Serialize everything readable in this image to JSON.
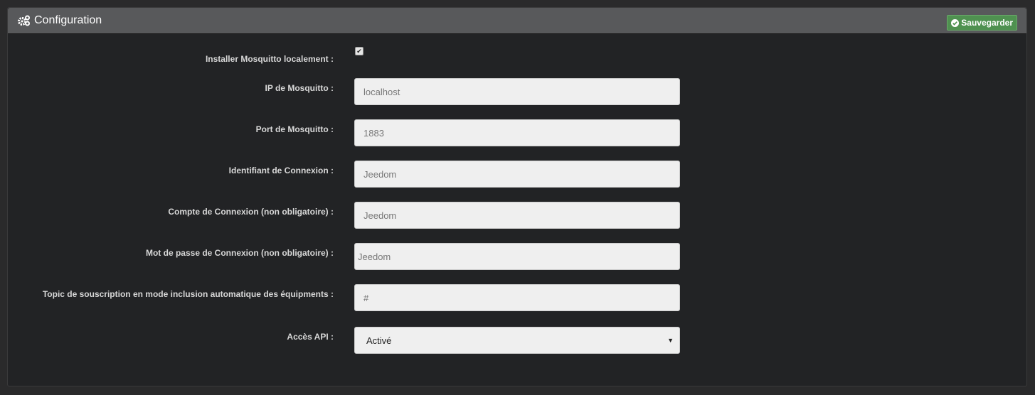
{
  "header": {
    "title": "Configuration",
    "icon": "cogs-icon",
    "save_label": "Sauvegarder",
    "save_icon": "check-circle-icon"
  },
  "form": {
    "install_label": "Installer Mosquitto localement :",
    "install_checked": true,
    "fields": [
      {
        "label": "IP de Mosquitto :",
        "value": "localhost"
      },
      {
        "label": "Port de Mosquitto :",
        "value": "1883"
      },
      {
        "label": "Identifiant de Connexion :",
        "value": "Jeedom"
      },
      {
        "label": "Compte de Connexion (non obligatoire) :",
        "value": "Jeedom"
      },
      {
        "label": "Mot de passe de Connexion (non obligatoire) :",
        "value": "Jeedom"
      },
      {
        "label": "Topic de souscription en mode inclusion automatique des équipments :",
        "value": "#"
      }
    ],
    "api_label": "Accès API :",
    "api_value": "Activé"
  },
  "colors": {
    "save": "#4f9150",
    "header": "#58595b",
    "panel": "#222325"
  }
}
